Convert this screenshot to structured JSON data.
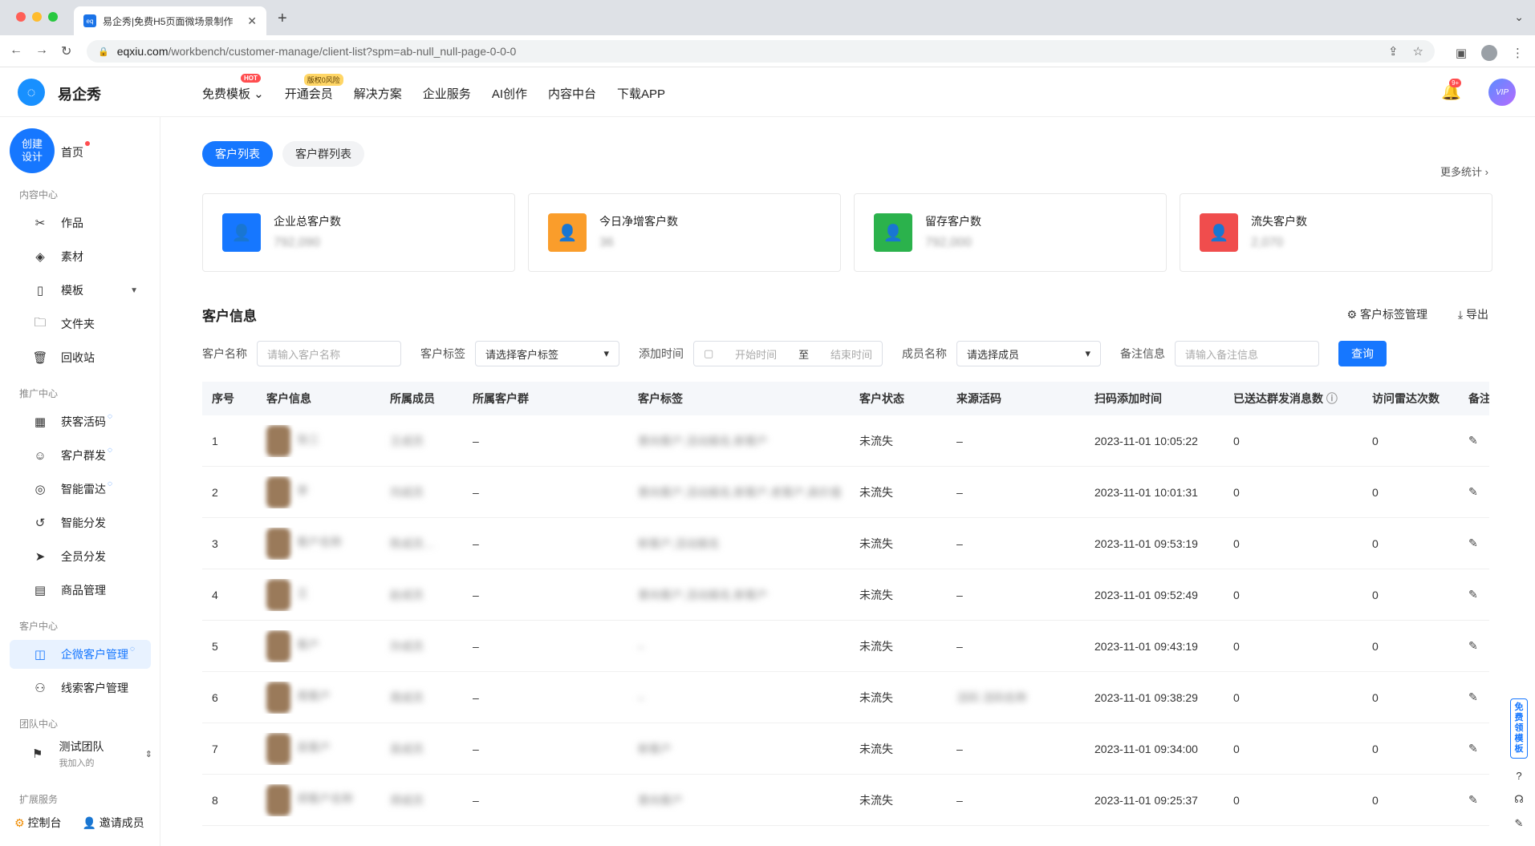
{
  "browser": {
    "tab_title": "易企秀|免费H5页面微场景制作",
    "favicon_text": "eq",
    "url_host": "eqxiu.com",
    "url_path": "/workbench/customer-manage/client-list?spm=ab-null_null-page-0-0-0"
  },
  "header": {
    "logo_text": "易企秀",
    "nav": [
      {
        "label": "免费模板",
        "badge": "HOT"
      },
      {
        "label": "开通会员",
        "badge": "版权0风险"
      },
      {
        "label": "解决方案"
      },
      {
        "label": "企业服务"
      },
      {
        "label": "AI创作"
      },
      {
        "label": "内容中台"
      },
      {
        "label": "下载APP"
      }
    ],
    "bell_count": "9+",
    "vip_label": "VIP"
  },
  "sidebar": {
    "create_label": "创建设计",
    "home_label": "首页",
    "sections": [
      "内容中心",
      "推广中心",
      "客户中心",
      "团队中心",
      "扩展服务"
    ],
    "items": [
      {
        "label": "作品",
        "icon": "tools-icon"
      },
      {
        "label": "素材",
        "icon": "layers-icon"
      },
      {
        "label": "模板",
        "icon": "template-icon"
      },
      {
        "label": "文件夹",
        "icon": "folder-icon"
      },
      {
        "label": "回收站",
        "icon": "trash-icon"
      },
      {
        "label": "获客活码",
        "icon": "qrcode-icon"
      },
      {
        "label": "客户群发",
        "icon": "user-send-icon"
      },
      {
        "label": "智能雷达",
        "icon": "radar-icon"
      },
      {
        "label": "智能分发",
        "icon": "distribute-icon"
      },
      {
        "label": "全员分发",
        "icon": "send-icon"
      },
      {
        "label": "商品管理",
        "icon": "goods-icon"
      },
      {
        "label": "企微客户管理",
        "icon": "wecom-customer-icon"
      },
      {
        "label": "线索客户管理",
        "icon": "lead-customer-icon"
      }
    ],
    "team_name": "测试团队",
    "team_sub": "我加入的",
    "footer_console": "控制台",
    "footer_invite": "邀请成员"
  },
  "main": {
    "tabs": [
      "客户列表",
      "客户群列表"
    ],
    "more_stats": "更多统计",
    "stats": [
      {
        "title": "企业总客户数",
        "value": "792,090",
        "color": "#1677ff"
      },
      {
        "title": "今日净增客户数",
        "value": "36",
        "color": "#fa9d2b"
      },
      {
        "title": "留存客户数",
        "value": "792,000",
        "color": "#2bb24c"
      },
      {
        "title": "流失客户数",
        "value": "2,070",
        "color": "#f04d4d"
      }
    ],
    "section_title": "客户信息",
    "tag_manage": "客户标签管理",
    "export": "导出",
    "filters": {
      "name_label": "客户名称",
      "name_placeholder": "请输入客户名称",
      "tag_label": "客户标签",
      "tag_value": "请选择客户标签",
      "time_label": "添加时间",
      "start_placeholder": "开始时间",
      "to": "至",
      "end_placeholder": "结束时间",
      "member_label": "成员名称",
      "member_value": "请选择成员",
      "remark_label": "备注信息",
      "remark_placeholder": "请输入备注信息",
      "query": "查询"
    },
    "columns": [
      "序号",
      "客户信息",
      "所属成员",
      "所属客户群",
      "客户标签",
      "客户状态",
      "来源活码",
      "扫码添加时间",
      "已送达群发消息数",
      "访问雷达次数",
      "备注"
    ],
    "rows": [
      {
        "idx": "1",
        "name": "张三",
        "member": "王成员",
        "group": "–",
        "tags": "意向客户,活动报名,新客户",
        "status": "未流失",
        "source": "–",
        "time": "2023-11-01 10:05:22",
        "sent": "0",
        "visits": "0"
      },
      {
        "idx": "2",
        "name": "李",
        "member": "刘成员",
        "group": "–",
        "tags": "意向客户,活动报名,新客户,老客户,高价值",
        "status": "未流失",
        "source": "–",
        "time": "2023-11-01 10:01:31",
        "sent": "0",
        "visits": "0"
      },
      {
        "idx": "3",
        "name": "客户名称",
        "member": "陈成员…",
        "group": "–",
        "tags": "新客户,活动报名",
        "status": "未流失",
        "source": "–",
        "time": "2023-11-01 09:53:19",
        "sent": "0",
        "visits": "0"
      },
      {
        "idx": "4",
        "name": "王",
        "member": "赵成员",
        "group": "–",
        "tags": "意向客户,活动报名,新客户",
        "status": "未流失",
        "source": "–",
        "time": "2023-11-01 09:52:49",
        "sent": "0",
        "visits": "0"
      },
      {
        "idx": "5",
        "name": "客户",
        "member": "孙成员",
        "group": "–",
        "tags": "–",
        "status": "未流失",
        "source": "–",
        "time": "2023-11-01 09:43:19",
        "sent": "0",
        "visits": "0"
      },
      {
        "idx": "6",
        "name": "周客户",
        "member": "周成员",
        "group": "–",
        "tags": "–",
        "status": "未流失",
        "source": "活码 活码名称",
        "time": "2023-11-01 09:38:29",
        "sent": "0",
        "visits": "0"
      },
      {
        "idx": "7",
        "name": "吴客户",
        "member": "吴成员",
        "group": "–",
        "tags": "新客户",
        "status": "未流失",
        "source": "–",
        "time": "2023-11-01 09:34:00",
        "sent": "0",
        "visits": "0"
      },
      {
        "idx": "8",
        "name": "郑客户名称",
        "member": "郑成员",
        "group": "–",
        "tags": "意向客户",
        "status": "未流失",
        "source": "–",
        "time": "2023-11-01 09:25:37",
        "sent": "0",
        "visits": "0"
      }
    ],
    "float_free": "免费领模板"
  }
}
